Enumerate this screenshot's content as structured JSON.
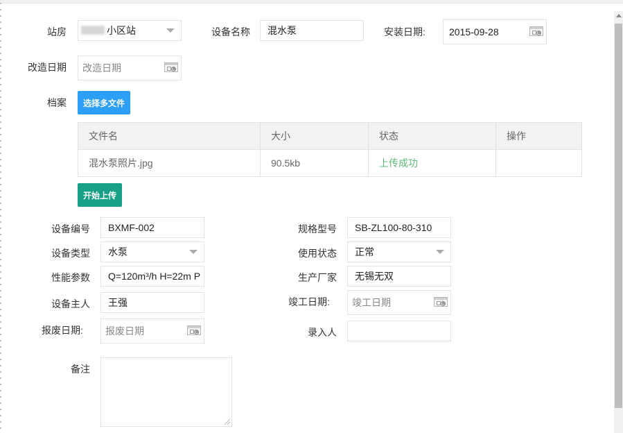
{
  "station": {
    "label": "站房",
    "value": "小区站"
  },
  "device_name": {
    "label": "设备名称",
    "value": "混水泵"
  },
  "install_date": {
    "label": "安装日期:",
    "value": "2015-09-28"
  },
  "renovation_date": {
    "label": "改造日期",
    "placeholder": "改造日期"
  },
  "archive": {
    "label": "档案",
    "select_button": "选择多文件",
    "upload_button": "开始上传",
    "columns": [
      "文件名",
      "大小",
      "状态",
      "操作"
    ],
    "rows": [
      {
        "name": "混水泵照片.jpg",
        "size": "90.5kb",
        "status": "上传成功",
        "action": ""
      }
    ]
  },
  "device_code": {
    "label": "设备编号",
    "value": "BXMF-002"
  },
  "spec_model": {
    "label": "规格型号",
    "value": "SB-ZL100-80-310"
  },
  "device_type": {
    "label": "设备类型",
    "value": "水泵"
  },
  "use_status": {
    "label": "使用状态",
    "value": "正常"
  },
  "performance": {
    "label": "性能参数",
    "value": "Q=120m³/h  H=22m  P"
  },
  "manufacturer": {
    "label": "生产厂家",
    "value": "无锡无双"
  },
  "owner": {
    "label": "设备主人",
    "value": "王强"
  },
  "completion_date": {
    "label": "竣工日期:",
    "placeholder": "竣工日期"
  },
  "scrap_date": {
    "label": "报废日期:",
    "placeholder": "报废日期"
  },
  "recorder": {
    "label": "录入人",
    "value": ""
  },
  "remark": {
    "label": "备注",
    "value": ""
  },
  "colors": {
    "select_button": "#2d9ff7",
    "upload_button": "#16a085",
    "status_success": "#5fb878"
  }
}
